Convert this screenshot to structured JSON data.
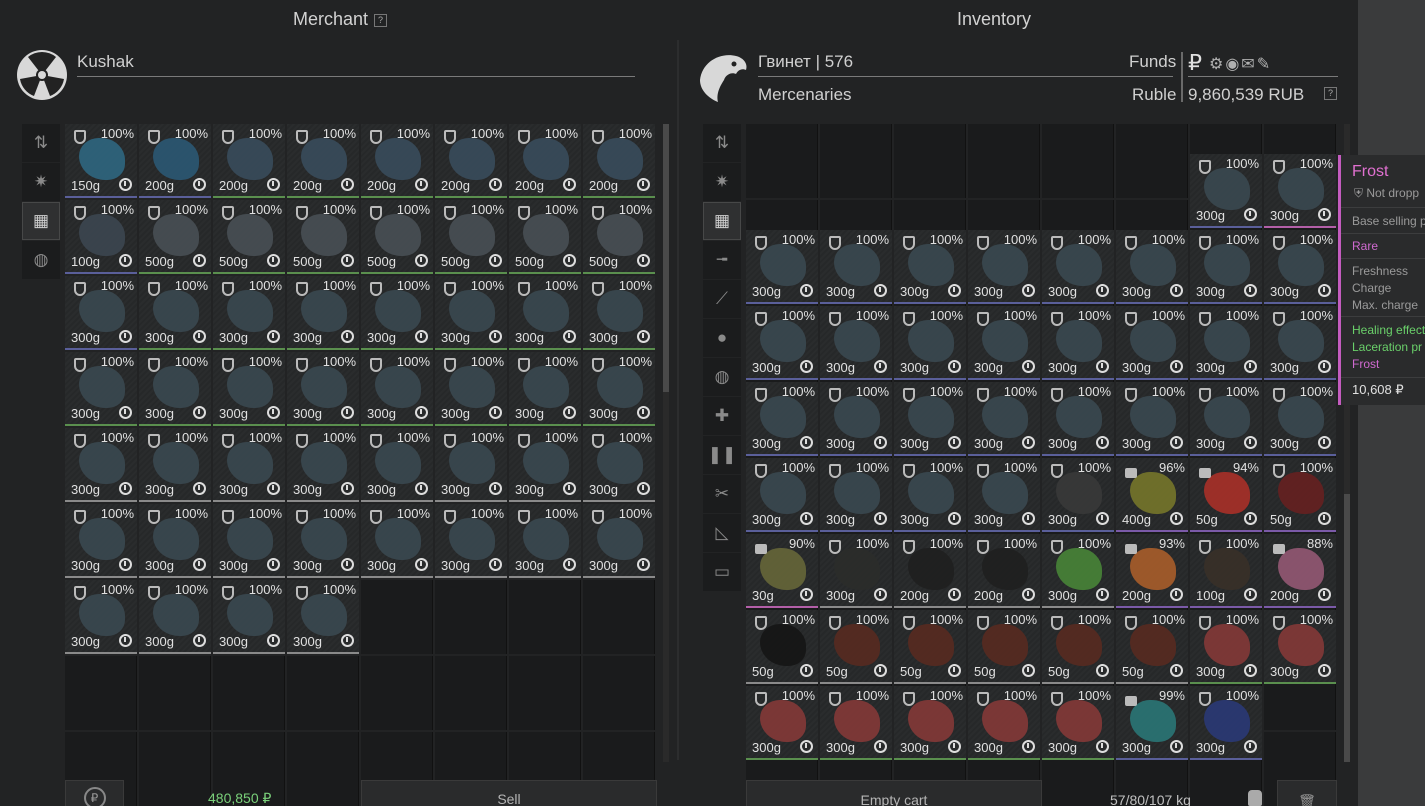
{
  "merchant": {
    "title": "Merchant",
    "help": "?",
    "trader_name": "Kushak",
    "total": "480,850 ₽",
    "sell_label": "Sell",
    "items": [
      {
        "pct": "100%",
        "wt": "150g",
        "color": "#2f6a85",
        "rim": "blue"
      },
      {
        "pct": "100%",
        "wt": "200g",
        "color": "#2b5a78",
        "rim": "blue"
      },
      {
        "pct": "100%",
        "wt": "200g",
        "color": "#3a4d5e",
        "rim": "green"
      },
      {
        "pct": "100%",
        "wt": "200g",
        "color": "#3a4d5e",
        "rim": "green"
      },
      {
        "pct": "100%",
        "wt": "200g",
        "color": "#3a4d5e",
        "rim": "green"
      },
      {
        "pct": "100%",
        "wt": "200g",
        "color": "#3a4d5e",
        "rim": "green"
      },
      {
        "pct": "100%",
        "wt": "200g",
        "color": "#3a4d5e",
        "rim": "green"
      },
      {
        "pct": "100%",
        "wt": "200g",
        "color": "#3a4d5e",
        "rim": "green"
      },
      {
        "pct": "100%",
        "wt": "100g",
        "color": "#3d4852",
        "rim": "blue"
      },
      {
        "pct": "100%",
        "wt": "500g",
        "color": "#4a5157",
        "rim": "green"
      },
      {
        "pct": "100%",
        "wt": "500g",
        "color": "#4a5157",
        "rim": "green"
      },
      {
        "pct": "100%",
        "wt": "500g",
        "color": "#4a5157",
        "rim": "green"
      },
      {
        "pct": "100%",
        "wt": "500g",
        "color": "#4a5157",
        "rim": "green"
      },
      {
        "pct": "100%",
        "wt": "500g",
        "color": "#4a5157",
        "rim": "green"
      },
      {
        "pct": "100%",
        "wt": "500g",
        "color": "#4a5157",
        "rim": "green"
      },
      {
        "pct": "100%",
        "wt": "500g",
        "color": "#4a5157",
        "rim": "green"
      },
      {
        "pct": "100%",
        "wt": "300g",
        "color": "#3b4a52",
        "rim": "blue"
      },
      {
        "pct": "100%",
        "wt": "300g",
        "color": "#3b4a52",
        "rim": "green"
      },
      {
        "pct": "100%",
        "wt": "300g",
        "color": "#3b4a52",
        "rim": "green"
      },
      {
        "pct": "100%",
        "wt": "300g",
        "color": "#3b4a52",
        "rim": "green"
      },
      {
        "pct": "100%",
        "wt": "300g",
        "color": "#3b4a52",
        "rim": "green"
      },
      {
        "pct": "100%",
        "wt": "300g",
        "color": "#3b4a52",
        "rim": "green"
      },
      {
        "pct": "100%",
        "wt": "300g",
        "color": "#3b4a52",
        "rim": "green"
      },
      {
        "pct": "100%",
        "wt": "300g",
        "color": "#3b4a52",
        "rim": "green"
      },
      {
        "pct": "100%",
        "wt": "300g",
        "color": "#3b4a52",
        "rim": "green"
      },
      {
        "pct": "100%",
        "wt": "300g",
        "color": "#3b4a52",
        "rim": "green"
      },
      {
        "pct": "100%",
        "wt": "300g",
        "color": "#3b4a52",
        "rim": "green"
      },
      {
        "pct": "100%",
        "wt": "300g",
        "color": "#3b4a52",
        "rim": "green"
      },
      {
        "pct": "100%",
        "wt": "300g",
        "color": "#3b4a52",
        "rim": "green"
      },
      {
        "pct": "100%",
        "wt": "300g",
        "color": "#3b4a52",
        "rim": "green"
      },
      {
        "pct": "100%",
        "wt": "300g",
        "color": "#3b4a52",
        "rim": "green"
      },
      {
        "pct": "100%",
        "wt": "300g",
        "color": "#3b4a52",
        "rim": "green"
      },
      {
        "pct": "100%",
        "wt": "300g",
        "color": "#3b4a52",
        "rim": "gray"
      },
      {
        "pct": "100%",
        "wt": "300g",
        "color": "#3b4a52",
        "rim": "gray"
      },
      {
        "pct": "100%",
        "wt": "300g",
        "color": "#3b4a52",
        "rim": "gray"
      },
      {
        "pct": "100%",
        "wt": "300g",
        "color": "#3b4a52",
        "rim": "gray"
      },
      {
        "pct": "100%",
        "wt": "300g",
        "color": "#3b4a52",
        "rim": "gray"
      },
      {
        "pct": "100%",
        "wt": "300g",
        "color": "#3b4a52",
        "rim": "gray"
      },
      {
        "pct": "100%",
        "wt": "300g",
        "color": "#3b4a52",
        "rim": "gray"
      },
      {
        "pct": "100%",
        "wt": "300g",
        "color": "#3b4a52",
        "rim": "gray"
      },
      {
        "pct": "100%",
        "wt": "300g",
        "color": "#3b4a52",
        "rim": "gray"
      },
      {
        "pct": "100%",
        "wt": "300g",
        "color": "#3b4a52",
        "rim": "gray"
      },
      {
        "pct": "100%",
        "wt": "300g",
        "color": "#3b4a52",
        "rim": "gray"
      },
      {
        "pct": "100%",
        "wt": "300g",
        "color": "#3b4a52",
        "rim": "gray"
      },
      {
        "pct": "100%",
        "wt": "300g",
        "color": "#3b4a52",
        "rim": "gray"
      },
      {
        "pct": "100%",
        "wt": "300g",
        "color": "#3b4a52",
        "rim": "gray"
      },
      {
        "pct": "100%",
        "wt": "300g",
        "color": "#3b4a52",
        "rim": "gray"
      },
      {
        "pct": "100%",
        "wt": "300g",
        "color": "#3b4a52",
        "rim": "gray"
      },
      {
        "pct": "100%",
        "wt": "300g",
        "color": "#3b4a52",
        "rim": "gray"
      },
      {
        "pct": "100%",
        "wt": "300g",
        "color": "#3b4a52",
        "rim": "gray"
      },
      {
        "pct": "100%",
        "wt": "300g",
        "color": "#3b4a52",
        "rim": "gray"
      },
      {
        "pct": "100%",
        "wt": "300g",
        "color": "#3b4a52",
        "rim": "gray"
      }
    ]
  },
  "inventory": {
    "title": "Inventory",
    "player_name": "Гвинет | 576",
    "faction": "Mercenaries",
    "funds_label": "Funds",
    "currency_label": "Ruble",
    "currency_symbol": "₽",
    "funds_value": "9,860,539 RUB",
    "help": "?",
    "empty_cart_label": "Empty cart",
    "weight": "57/80/107 kg",
    "top_items": [
      {
        "pct": "100%",
        "wt": "300g",
        "color": "#3b4a52",
        "rim": "blue"
      },
      {
        "pct": "100%",
        "wt": "300g",
        "color": "#3b4a52",
        "rim": "pink"
      }
    ],
    "items": [
      {
        "pct": "100%",
        "wt": "300g",
        "color": "#3b4a52",
        "rim": "blue",
        "icon": "shield"
      },
      {
        "pct": "100%",
        "wt": "300g",
        "color": "#3b4a52",
        "rim": "blue",
        "icon": "shield"
      },
      {
        "pct": "100%",
        "wt": "300g",
        "color": "#3b4a52",
        "rim": "blue",
        "icon": "shield"
      },
      {
        "pct": "100%",
        "wt": "300g",
        "color": "#3b4a52",
        "rim": "blue",
        "icon": "shield"
      },
      {
        "pct": "100%",
        "wt": "300g",
        "color": "#3b4a52",
        "rim": "blue",
        "icon": "shield"
      },
      {
        "pct": "100%",
        "wt": "300g",
        "color": "#3b4a52",
        "rim": "blue",
        "icon": "shield"
      },
      {
        "pct": "100%",
        "wt": "300g",
        "color": "#3b4a52",
        "rim": "blue",
        "icon": "shield"
      },
      {
        "pct": "100%",
        "wt": "300g",
        "color": "#3b4a52",
        "rim": "blue",
        "icon": "shield"
      },
      {
        "pct": "100%",
        "wt": "300g",
        "color": "#3b4a52",
        "rim": "blue",
        "icon": "shield"
      },
      {
        "pct": "100%",
        "wt": "300g",
        "color": "#3b4a52",
        "rim": "blue",
        "icon": "shield"
      },
      {
        "pct": "100%",
        "wt": "300g",
        "color": "#3b4a52",
        "rim": "blue",
        "icon": "shield"
      },
      {
        "pct": "100%",
        "wt": "300g",
        "color": "#3b4a52",
        "rim": "blue",
        "icon": "shield"
      },
      {
        "pct": "100%",
        "wt": "300g",
        "color": "#3b4a52",
        "rim": "blue",
        "icon": "shield"
      },
      {
        "pct": "100%",
        "wt": "300g",
        "color": "#3b4a52",
        "rim": "blue",
        "icon": "shield"
      },
      {
        "pct": "100%",
        "wt": "300g",
        "color": "#3b4a52",
        "rim": "blue",
        "icon": "shield"
      },
      {
        "pct": "100%",
        "wt": "300g",
        "color": "#3b4a52",
        "rim": "blue",
        "icon": "shield"
      },
      {
        "pct": "100%",
        "wt": "300g",
        "color": "#3b4a52",
        "rim": "blue",
        "icon": "shield"
      },
      {
        "pct": "100%",
        "wt": "300g",
        "color": "#3b4a52",
        "rim": "blue",
        "icon": "shield"
      },
      {
        "pct": "100%",
        "wt": "300g",
        "color": "#3b4a52",
        "rim": "blue",
        "icon": "shield"
      },
      {
        "pct": "100%",
        "wt": "300g",
        "color": "#3b4a52",
        "rim": "blue",
        "icon": "shield"
      },
      {
        "pct": "100%",
        "wt": "300g",
        "color": "#3b4a52",
        "rim": "blue",
        "icon": "shield"
      },
      {
        "pct": "100%",
        "wt": "300g",
        "color": "#3b4a52",
        "rim": "blue",
        "icon": "shield"
      },
      {
        "pct": "100%",
        "wt": "300g",
        "color": "#3b4a52",
        "rim": "blue",
        "icon": "shield"
      },
      {
        "pct": "100%",
        "wt": "300g",
        "color": "#3b4a52",
        "rim": "blue",
        "icon": "shield"
      },
      {
        "pct": "100%",
        "wt": "300g",
        "color": "#3b4a52",
        "rim": "blue",
        "icon": "shield"
      },
      {
        "pct": "100%",
        "wt": "300g",
        "color": "#3b4a52",
        "rim": "blue",
        "icon": "shield"
      },
      {
        "pct": "100%",
        "wt": "300g",
        "color": "#3b4a52",
        "rim": "blue",
        "icon": "shield"
      },
      {
        "pct": "100%",
        "wt": "300g",
        "color": "#3b4a52",
        "rim": "blue",
        "icon": "shield"
      },
      {
        "pct": "100%",
        "wt": "300g",
        "color": "#3a3a3a",
        "rim": "blue",
        "icon": "shield"
      },
      {
        "pct": "96%",
        "wt": "400g",
        "color": "#7a7a2a",
        "rim": "purple",
        "icon": "lock"
      },
      {
        "pct": "94%",
        "wt": "50g",
        "color": "#b03028",
        "rim": "purple",
        "icon": "lock"
      },
      {
        "pct": "100%",
        "wt": "50g",
        "color": "#6a2020",
        "rim": "purple",
        "icon": "shield"
      },
      {
        "pct": "90%",
        "wt": "30g",
        "color": "#6a6a3a",
        "rim": "pink",
        "icon": "lock"
      },
      {
        "pct": "100%",
        "wt": "300g",
        "color": "#2b2d2a",
        "rim": "gray",
        "icon": "shield"
      },
      {
        "pct": "100%",
        "wt": "200g",
        "color": "#1e1e1e",
        "rim": "gray",
        "icon": "shield"
      },
      {
        "pct": "100%",
        "wt": "200g",
        "color": "#1e1e1e",
        "rim": "gray",
        "icon": "shield"
      },
      {
        "pct": "100%",
        "wt": "300g",
        "color": "#4a8a38",
        "rim": "gray",
        "icon": "shield"
      },
      {
        "pct": "93%",
        "wt": "200g",
        "color": "#b0602a",
        "rim": "purple",
        "icon": "lock"
      },
      {
        "pct": "100%",
        "wt": "100g",
        "color": "#3a3028",
        "rim": "purple",
        "icon": "shield"
      },
      {
        "pct": "88%",
        "wt": "200g",
        "color": "#9a5a78",
        "rim": "purple",
        "icon": "lock"
      },
      {
        "pct": "100%",
        "wt": "50g",
        "color": "#141414",
        "rim": "gray",
        "icon": "shield"
      },
      {
        "pct": "100%",
        "wt": "50g",
        "color": "#5a2a20",
        "rim": "gray",
        "icon": "shield"
      },
      {
        "pct": "100%",
        "wt": "50g",
        "color": "#5a2a20",
        "rim": "gray",
        "icon": "shield"
      },
      {
        "pct": "100%",
        "wt": "50g",
        "color": "#5a2a20",
        "rim": "gray",
        "icon": "shield"
      },
      {
        "pct": "100%",
        "wt": "50g",
        "color": "#5a2a20",
        "rim": "gray",
        "icon": "shield"
      },
      {
        "pct": "100%",
        "wt": "50g",
        "color": "#5a2a20",
        "rim": "gray",
        "icon": "shield"
      },
      {
        "pct": "100%",
        "wt": "300g",
        "color": "#8a3a38",
        "rim": "green",
        "icon": "shield"
      },
      {
        "pct": "100%",
        "wt": "300g",
        "color": "#8a3a38",
        "rim": "green",
        "icon": "shield"
      },
      {
        "pct": "100%",
        "wt": "300g",
        "color": "#8a3a38",
        "rim": "green",
        "icon": "shield"
      },
      {
        "pct": "100%",
        "wt": "300g",
        "color": "#8a3a38",
        "rim": "green",
        "icon": "shield"
      },
      {
        "pct": "100%",
        "wt": "300g",
        "color": "#8a3a38",
        "rim": "green",
        "icon": "shield"
      },
      {
        "pct": "100%",
        "wt": "300g",
        "color": "#8a3a38",
        "rim": "green",
        "icon": "shield"
      },
      {
        "pct": "100%",
        "wt": "300g",
        "color": "#8a3a38",
        "rim": "green",
        "icon": "shield"
      },
      {
        "pct": "99%",
        "wt": "300g",
        "color": "#2a7a7a",
        "rim": "blue",
        "icon": "lock"
      },
      {
        "pct": "100%",
        "wt": "300g",
        "color": "#2a3a7a",
        "rim": "blue",
        "icon": "shield"
      }
    ]
  },
  "tooltip": {
    "name": "Frost",
    "drop": "Not dropp",
    "base_price": "Base selling p",
    "rarity": "Rare",
    "freshness": "Freshness",
    "charge": "Charge",
    "max_charge": "Max. charge",
    "effect1": "Healing effect",
    "effect2": "Laceration pr",
    "effect3": "Frost",
    "price": "10,608 ₽",
    "colors": {
      "rarity": "#d06ad0",
      "effect_good": "#6ad06a",
      "effect_bad": "#d06ad0"
    }
  },
  "colors": {
    "total_green": "#7ad07a"
  }
}
